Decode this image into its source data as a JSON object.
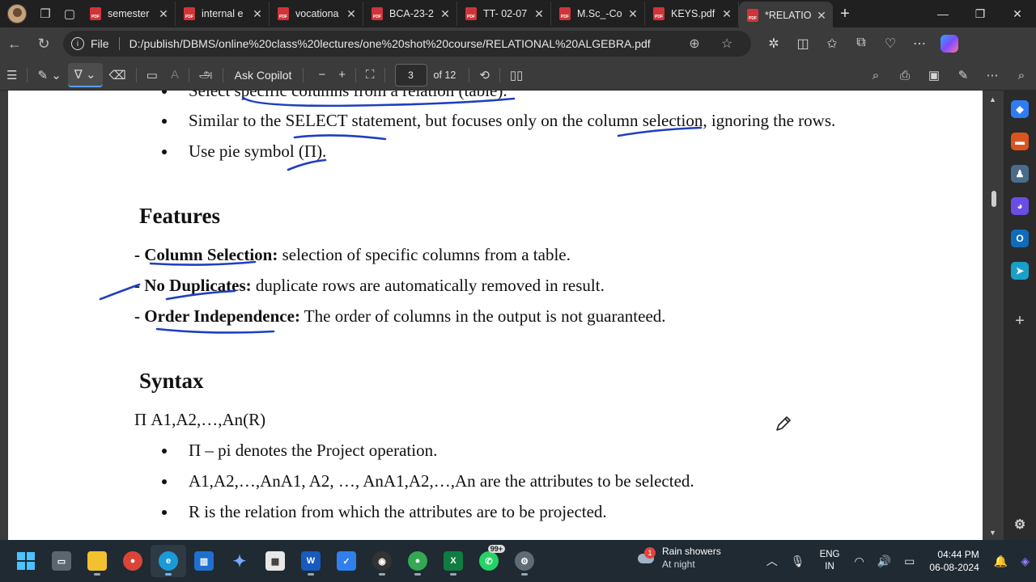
{
  "browser": {
    "tabs": [
      {
        "label": "semester",
        "type": "pdf"
      },
      {
        "label": "internal e",
        "type": "pdf"
      },
      {
        "label": "vocationa",
        "type": "pdf"
      },
      {
        "label": "BCA-23-2",
        "type": "pdf"
      },
      {
        "label": "TT- 02-07",
        "type": "pdf"
      },
      {
        "label": "M.Sc_-Co",
        "type": "pdf"
      },
      {
        "label": "KEYS.pdf",
        "type": "pdf"
      },
      {
        "label": "*RELATIO",
        "type": "pdf",
        "active": true
      }
    ],
    "address": {
      "scheme_label": "File",
      "url": "D:/publish/DBMS/online%20class%20lectures/one%20shot%20course/RELATIONAL%20ALGEBRA.pdf"
    }
  },
  "pdf_toolbar": {
    "ask_copilot": "Ask Copilot",
    "page_number": "3",
    "page_count": "of 12",
    "read_aloud_glyph": "அ"
  },
  "document": {
    "bullets_top": [
      "Select specific columns from a relation (table).",
      "Similar to the SELECT statement, but focuses only on the column selection, ignoring the rows.",
      "Use pie symbol (Π)."
    ],
    "features_heading": "Features",
    "features": [
      {
        "bold": "- Column Selection:",
        "text": " selection of specific columns from a table."
      },
      {
        "bold": "- No Duplicates:",
        "text": " duplicate rows are automatically removed in result."
      },
      {
        "bold": "- Order Independence:",
        "text": " The order of columns in the output is not guaranteed."
      }
    ],
    "syntax_heading": "Syntax",
    "syntax_line": "Π A1,A2,…,An(R)",
    "syntax_bullets": [
      "Π – pi denotes the Project operation.",
      "A1,A2,…,AnA1, A2, …, AnA1,A2,…,An are the attributes to be selected.",
      "R is the relation from which the attributes are to be projected."
    ],
    "ink_color": "#1f3fbf"
  },
  "taskbar": {
    "weather_badge": "1",
    "weather_title": "Rain showers",
    "weather_sub": "At night",
    "notif_badge": "99+",
    "lang_line1": "ENG",
    "lang_line2": "IN",
    "time": "04:44 PM",
    "date": "06-08-2024"
  }
}
